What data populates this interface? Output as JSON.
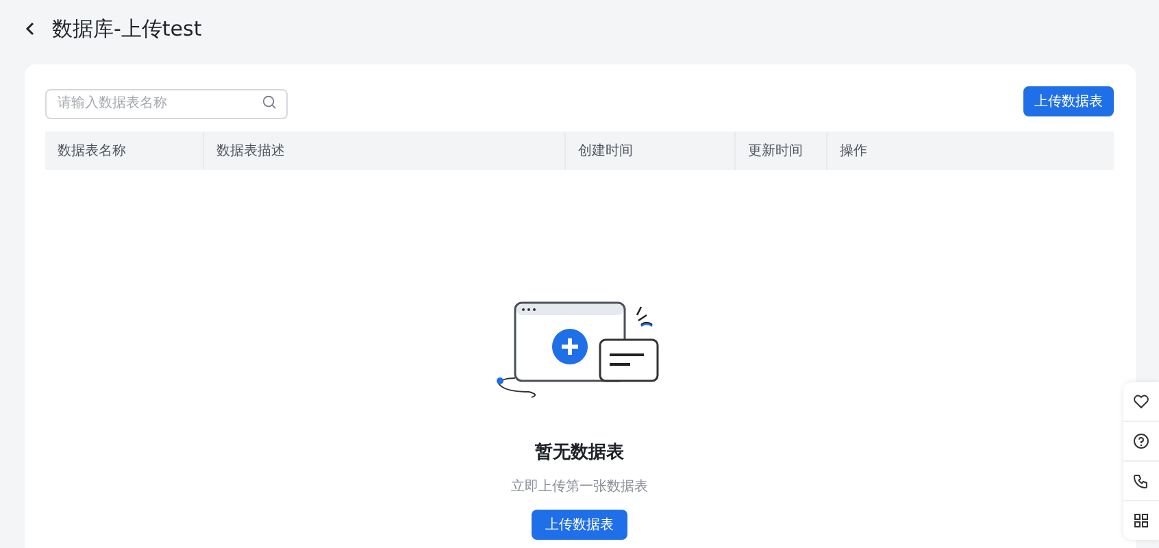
{
  "page": {
    "title": "数据库-上传test"
  },
  "search": {
    "placeholder": "请输入数据表名称"
  },
  "upload_button": "上传数据表",
  "table": {
    "columns": [
      "数据表名称",
      "数据表描述",
      "创建时间",
      "更新时间",
      "操作"
    ]
  },
  "empty_state": {
    "title": "暂无数据表",
    "description": "立即上传第一张数据表",
    "button": "上传数据表"
  },
  "side_tools": [
    {
      "kind": "heart"
    },
    {
      "kind": "help"
    },
    {
      "kind": "phone"
    },
    {
      "kind": "grid"
    }
  ]
}
